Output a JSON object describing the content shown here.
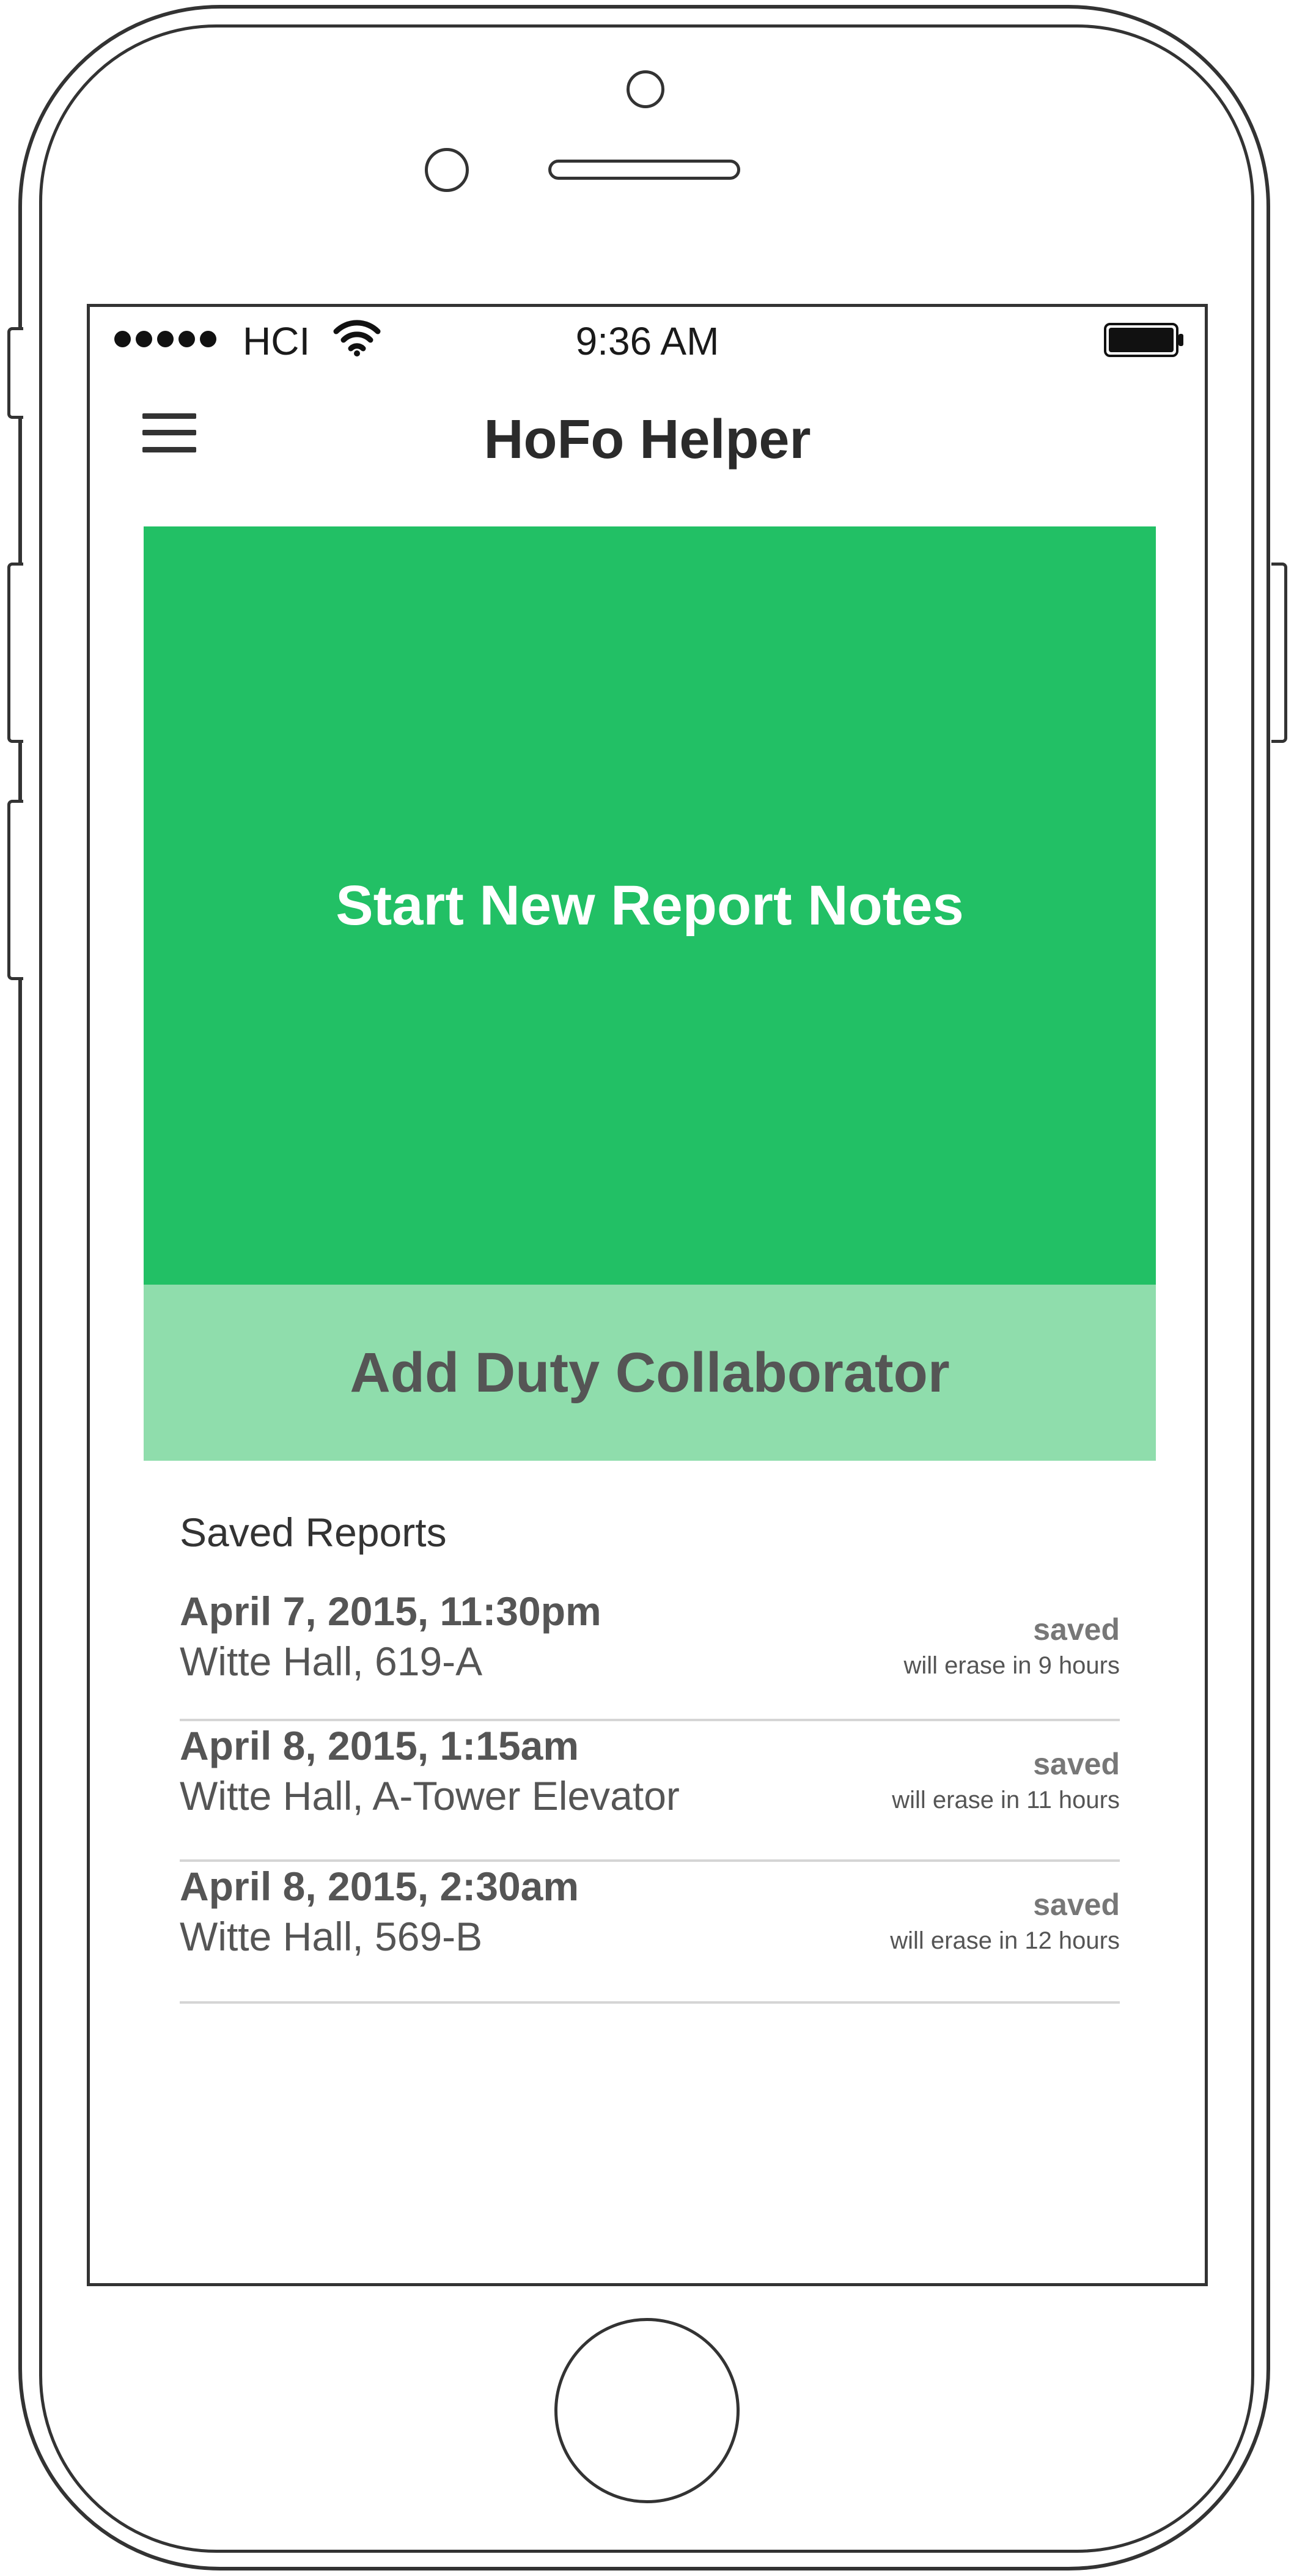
{
  "status_bar": {
    "carrier": "HCI",
    "time": "9:36 AM",
    "signal_bars": 5,
    "icons": [
      "wifi-icon",
      "battery-icon"
    ]
  },
  "nav": {
    "title": "HoFo Helper",
    "menu_icon": "hamburger-menu-icon"
  },
  "actions": {
    "start_report_label": "Start New Report Notes",
    "add_collaborator_label": "Add Duty Collaborator"
  },
  "saved_reports": {
    "heading": "Saved Reports",
    "items": [
      {
        "date": "April 7, 2015, 11:30pm",
        "location": "Witte Hall, 619-A",
        "status": "saved",
        "erase_note": "will erase in 9 hours"
      },
      {
        "date": "April 8, 2015, 1:15am",
        "location": "Witte Hall, A-Tower Elevator",
        "status": "saved",
        "erase_note": "will erase in 11 hours"
      },
      {
        "date": "April 8, 2015, 2:30am",
        "location": "Witte Hall, 569-B",
        "status": "saved",
        "erase_note": "will erase in 12 hours"
      }
    ]
  },
  "colors": {
    "primary_green": "#22c065",
    "light_green": "#8fddac",
    "frame": "#333333"
  }
}
